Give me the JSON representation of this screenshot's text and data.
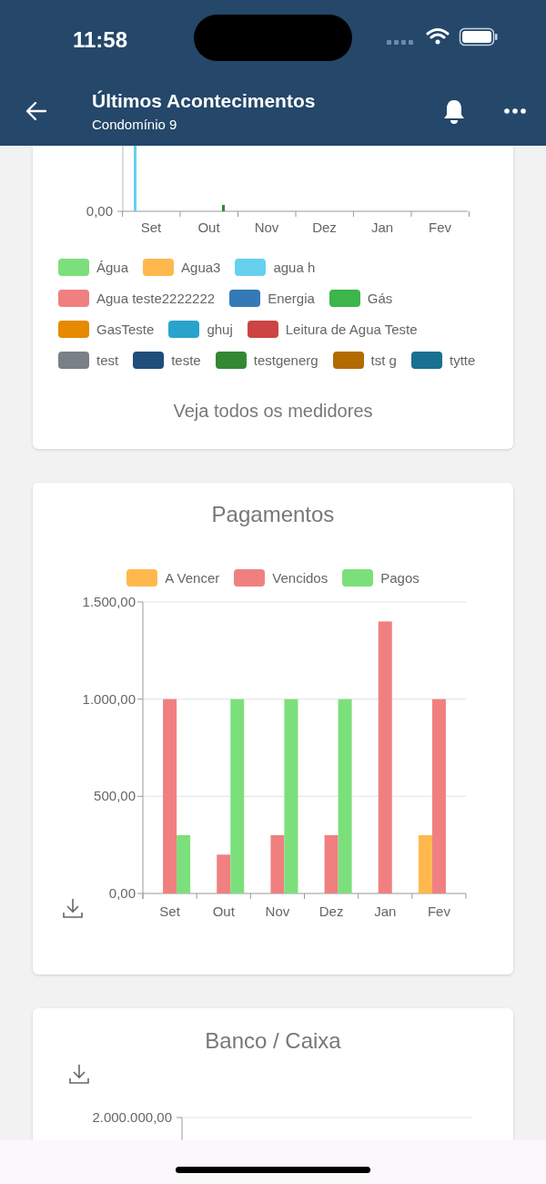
{
  "status_bar": {
    "time": "11:58"
  },
  "header": {
    "title": "Últimos Acontecimentos",
    "subtitle": "Condomínio 9"
  },
  "meters_card": {
    "y_tick": "0,00",
    "x_labels": [
      "Set",
      "Out",
      "Nov",
      "Dez",
      "Jan",
      "Fev"
    ],
    "legend_rows": [
      [
        {
          "label": "Água",
          "color": "#7be07b"
        },
        {
          "label": "Agua3",
          "color": "#ffb84d"
        },
        {
          "label": "agua h",
          "color": "#66d1ee"
        }
      ],
      [
        {
          "label": "Agua teste2222222",
          "color": "#f08080"
        },
        {
          "label": "Energia",
          "color": "#337ab7"
        },
        {
          "label": "Gás",
          "color": "#3cb54a"
        }
      ],
      [
        {
          "label": "GasTeste",
          "color": "#e68a00"
        },
        {
          "label": "ghuj",
          "color": "#29a3cc"
        },
        {
          "label": "Leitura de Agua Teste",
          "color": "#cc4444"
        }
      ],
      [
        {
          "label": "test",
          "color": "#7a8088"
        },
        {
          "label": "teste",
          "color": "#1f4e7a"
        },
        {
          "label": "testgenerg",
          "color": "#338833"
        },
        {
          "label": "tst g",
          "color": "#b36b00"
        },
        {
          "label": "tytte",
          "color": "#1a7090"
        }
      ]
    ],
    "link": "Veja todos os medidores"
  },
  "payments_card": {
    "title": "Pagamentos",
    "chart_data": {
      "type": "bar",
      "categories": [
        "Set",
        "Out",
        "Nov",
        "Dez",
        "Jan",
        "Fev"
      ],
      "series": [
        {
          "name": "A Vencer",
          "color": "#ffb84d",
          "values": [
            0,
            0,
            0,
            0,
            0,
            300
          ]
        },
        {
          "name": "Vencidos",
          "color": "#f08080",
          "values": [
            1000,
            200,
            300,
            300,
            1400,
            1000
          ]
        },
        {
          "name": "Pagos",
          "color": "#7be07b",
          "values": [
            300,
            1000,
            1000,
            1000,
            0,
            0
          ]
        }
      ],
      "ylim": [
        0,
        1500
      ],
      "yticks": [
        {
          "value": 0,
          "label": "0,00"
        },
        {
          "value": 500,
          "label": "500,00"
        },
        {
          "value": 1000,
          "label": "1.000,00"
        },
        {
          "value": 1500,
          "label": "1.500,00"
        }
      ]
    }
  },
  "bank_card": {
    "title": "Banco / Caixa",
    "y_tick": "2.000.000,00"
  }
}
